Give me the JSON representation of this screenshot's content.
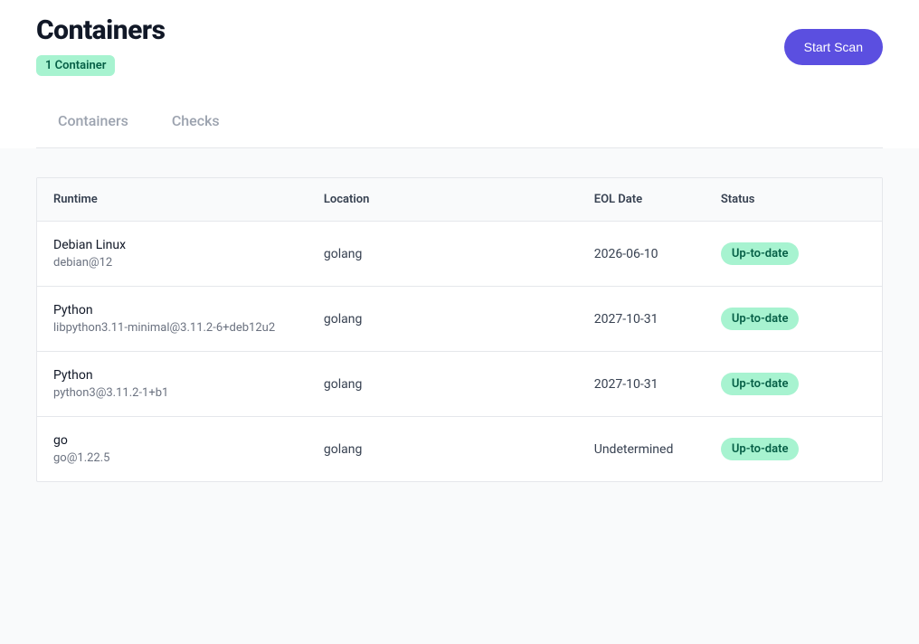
{
  "header": {
    "title": "Containers",
    "count_badge": "1 Container",
    "scan_button": "Start Scan"
  },
  "tabs": [
    {
      "label": "Containers"
    },
    {
      "label": "Checks"
    }
  ],
  "table": {
    "columns": {
      "runtime": "Runtime",
      "location": "Location",
      "eol_date": "EOL Date",
      "status": "Status"
    },
    "rows": [
      {
        "name": "Debian Linux",
        "version": "debian@12",
        "location": "golang",
        "eol_date": "2026-06-10",
        "status": "Up-to-date"
      },
      {
        "name": "Python",
        "version": "libpython3.11-minimal@3.11.2-6+deb12u2",
        "location": "golang",
        "eol_date": "2027-10-31",
        "status": "Up-to-date"
      },
      {
        "name": "Python",
        "version": "python3@3.11.2-1+b1",
        "location": "golang",
        "eol_date": "2027-10-31",
        "status": "Up-to-date"
      },
      {
        "name": "go",
        "version": "go@1.22.5",
        "location": "golang",
        "eol_date": "Undetermined",
        "status": "Up-to-date"
      }
    ]
  }
}
